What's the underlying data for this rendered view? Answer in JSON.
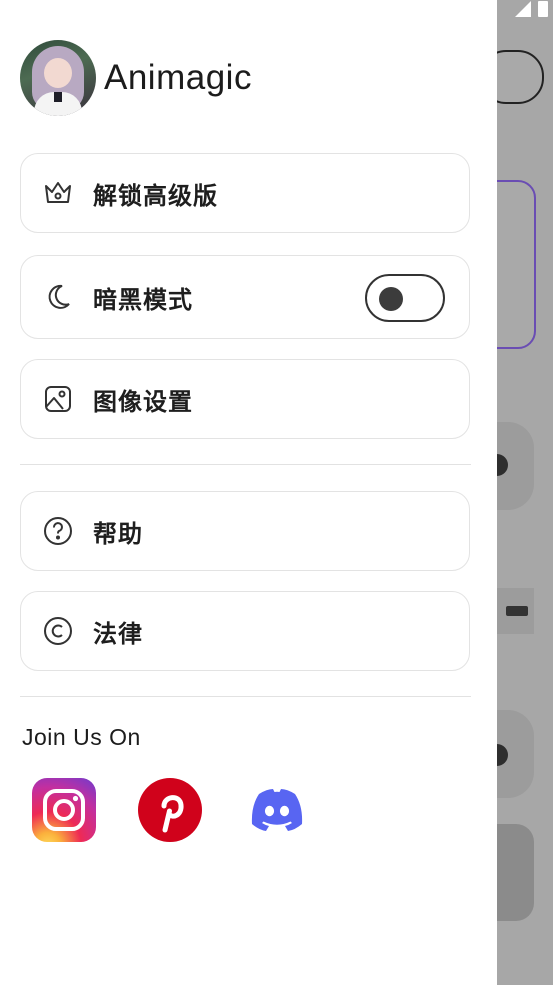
{
  "app": {
    "name": "Animagic"
  },
  "menu": {
    "unlock_premium": "解锁高级版",
    "dark_mode": "暗黑模式",
    "dark_mode_enabled": false,
    "image_settings": "图像设置",
    "help": "帮助",
    "legal": "法律"
  },
  "social": {
    "heading": "Join Us On",
    "links": [
      "instagram-icon",
      "pinterest-icon",
      "discord-icon"
    ]
  },
  "colors": {
    "drawer_bg": "#ffffff",
    "accent_purple": "#6a4db3",
    "discord": "#5865F2",
    "pinterest": "#d0021b"
  }
}
